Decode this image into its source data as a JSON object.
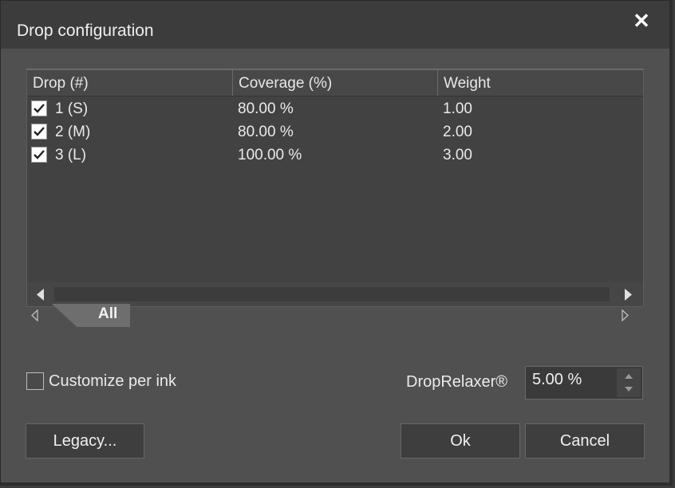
{
  "dialog": {
    "title": "Drop configuration",
    "close_icon": "close-icon"
  },
  "table": {
    "columns": [
      "Drop (#)",
      "Coverage (%)",
      "Weight"
    ],
    "rows": [
      {
        "checked": true,
        "drop": "1 (S)",
        "coverage": "80.00 %",
        "weight": "1.00"
      },
      {
        "checked": true,
        "drop": "2 (M)",
        "coverage": "80.00 %",
        "weight": "2.00"
      },
      {
        "checked": true,
        "drop": "3 (L)",
        "coverage": "100.00 %",
        "weight": "3.00"
      }
    ]
  },
  "tabs": {
    "items": [
      {
        "label": "All",
        "selected": true
      }
    ]
  },
  "options": {
    "customize_label": "Customize per ink",
    "customize_checked": false,
    "droprelaxer_label": "DropRelaxer®",
    "droprelaxer_value": "5.00 %"
  },
  "buttons": {
    "legacy": "Legacy...",
    "ok": "Ok",
    "cancel": "Cancel"
  },
  "colors": {
    "background": "#505050",
    "titlebar": "#3c3c3c",
    "list_background": "#424242"
  }
}
